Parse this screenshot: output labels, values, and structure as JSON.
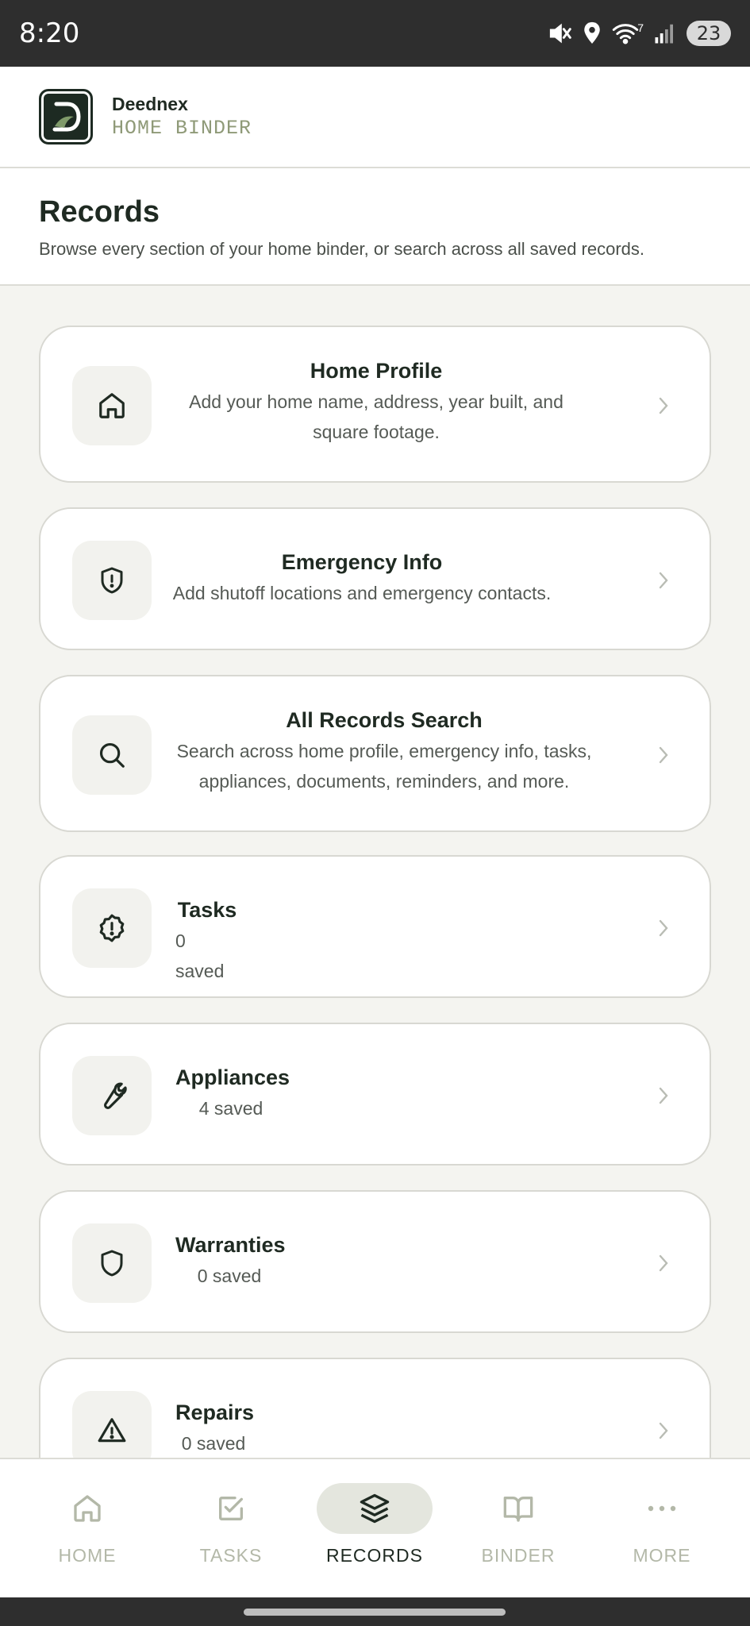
{
  "status_bar": {
    "time": "8:20",
    "battery": "23",
    "wifi_badge": "7",
    "icons": [
      "mute-icon",
      "location-icon",
      "wifi-icon",
      "signal-icon",
      "battery-icon"
    ]
  },
  "header": {
    "brand_name": "Deednex",
    "brand_sub": "HOME BINDER"
  },
  "page": {
    "title": "Records",
    "subtitle": "Browse every section of your home binder, or search across all saved records."
  },
  "records": [
    {
      "title": "Home Profile",
      "desc": "Add your home name, address, year built, and square footage.",
      "icon": "home-icon"
    },
    {
      "title": "Emergency Info",
      "desc": "Add shutoff locations and emergency contacts.",
      "icon": "shield-alert-icon"
    },
    {
      "title": "All Records Search",
      "desc": "Search across home profile, emergency info, tasks, appliances, documents, reminders, and more.",
      "icon": "search-icon"
    },
    {
      "title": "Tasks",
      "desc": "0 saved",
      "icon": "badge-alert-icon"
    },
    {
      "title": "Appliances",
      "desc": "4 saved",
      "icon": "wrench-icon"
    },
    {
      "title": "Warranties",
      "desc": "0 saved",
      "icon": "shield-icon"
    },
    {
      "title": "Repairs",
      "desc": "0 saved",
      "icon": "warning-triangle-icon"
    }
  ],
  "nav": {
    "items": [
      {
        "label": "HOME",
        "icon": "home-icon",
        "active": false
      },
      {
        "label": "TASKS",
        "icon": "checkbox-icon",
        "active": false
      },
      {
        "label": "RECORDS",
        "icon": "layers-icon",
        "active": true
      },
      {
        "label": "BINDER",
        "icon": "book-icon",
        "active": false
      },
      {
        "label": "MORE",
        "icon": "more-icon",
        "active": false
      }
    ]
  },
  "colors": {
    "primary_text": "#1f2a22",
    "accent_muted": "#8f9a78",
    "nav_inactive": "#b3b8a8",
    "background": "#f4f4f0"
  }
}
